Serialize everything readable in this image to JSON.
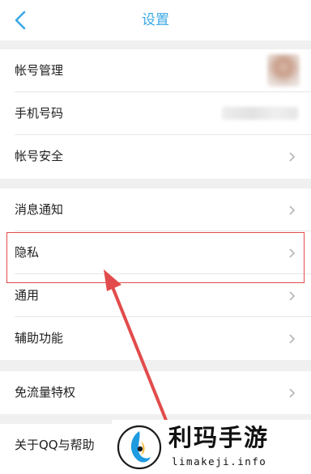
{
  "header": {
    "title": "设置"
  },
  "settings": {
    "group1": [
      {
        "label": "帐号管理"
      },
      {
        "label": "手机号码"
      },
      {
        "label": "帐号安全"
      }
    ],
    "group2": [
      {
        "label": "消息通知"
      },
      {
        "label": "隐私"
      },
      {
        "label": "通用"
      },
      {
        "label": "辅助功能"
      }
    ],
    "group3": [
      {
        "label": "免流量特权"
      }
    ],
    "group4": [
      {
        "label": "关于QQ与帮助"
      }
    ]
  },
  "watermark": {
    "title": "利玛手游",
    "url": "limakeji.info"
  },
  "colors": {
    "accent": "#3aa8e6",
    "highlight": "#e24b4b"
  }
}
